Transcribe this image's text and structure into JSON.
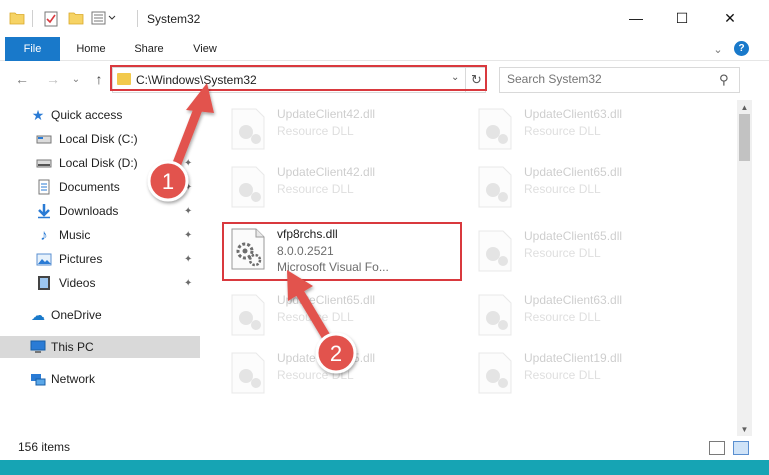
{
  "window": {
    "title": "System32",
    "minimize_glyph": "—",
    "maximize_glyph": "☐",
    "close_glyph": "✕"
  },
  "ribbon": {
    "tabs": [
      "File",
      "Home",
      "Share",
      "View"
    ],
    "collapse_glyph": "⌄",
    "help_glyph": "?"
  },
  "nav": {
    "back_glyph": "←",
    "forward_glyph": "→",
    "recent_glyph": "⌄",
    "up_glyph": "↑",
    "address": "C:\\Windows\\System32",
    "dropdown_glyph": "⌄",
    "refresh_glyph": "↻",
    "search_placeholder": "Search System32",
    "search_glyph": "⚲"
  },
  "sidebar": {
    "quick_access": "Quick access",
    "items": [
      {
        "label": "Local Disk (C:)",
        "icon": "drive-icon"
      },
      {
        "label": "Local Disk (D:)",
        "icon": "drive-icon"
      },
      {
        "label": "Documents",
        "icon": "documents-icon"
      },
      {
        "label": "Downloads",
        "icon": "downloads-icon"
      },
      {
        "label": "Music",
        "icon": "music-icon"
      },
      {
        "label": "Pictures",
        "icon": "pictures-icon"
      },
      {
        "label": "Videos",
        "icon": "videos-icon"
      }
    ],
    "onedrive": "OneDrive",
    "this_pc": "This PC",
    "network": "Network",
    "pin_glyph": "📌"
  },
  "files": {
    "highlighted": {
      "name": "vfp8rchs.dll",
      "version": "8.0.0.2521",
      "description": "Microsoft Visual Fo..."
    },
    "left_column": [
      {
        "name": "UpdateClient42.dll",
        "type": "Resource DLL"
      },
      {
        "name": "UpdateClient42.dll",
        "type": "Resource DLL"
      },
      {
        "name": "UpdateClient65.dll",
        "type": "Resource DLL"
      },
      {
        "name": "UpdateClient65.dll",
        "type": "Resource DLL"
      }
    ],
    "right_column": [
      {
        "name": "UpdateClient63.dll",
        "type": "Resource DLL"
      },
      {
        "name": "UpdateClient65.dll",
        "type": "Resource DLL"
      },
      {
        "name": "UpdateClient65.dll",
        "type": "Resource DLL"
      },
      {
        "name": "UpdateClient63.dll",
        "type": "Resource DLL"
      },
      {
        "name": "UpdateClient19.dll",
        "type": "Resource DLL"
      }
    ]
  },
  "status": {
    "item_count": "156 items"
  },
  "annotations": {
    "step1": "1",
    "step2": "2"
  },
  "colors": {
    "accent": "#1979ca",
    "highlight": "#d9393e",
    "taskbar": "#16a4b4"
  }
}
